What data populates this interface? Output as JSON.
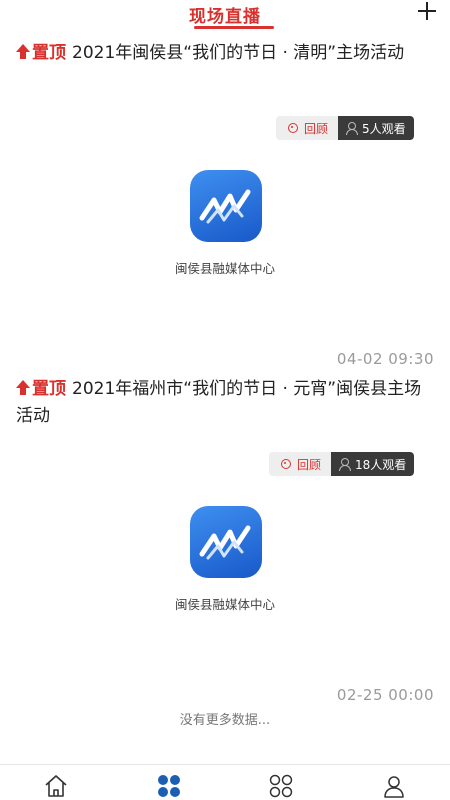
{
  "header": {
    "title": "现场直播"
  },
  "pin_label": "置顶",
  "items": [
    {
      "title": "2021年闽侯县“我们的节日 · 清明”主场活动",
      "replay_label": "回顾",
      "views_label": "5人观看",
      "logo_caption": "闽侯县融媒体中心",
      "time": "04-02 09:30"
    },
    {
      "title": "2021年福州市“我们的节日 · 元宵”闽侯县主场活动",
      "replay_label": "回顾",
      "views_label": "18人观看",
      "logo_caption": "闽侯县融媒体中心",
      "time": "02-25 00:00"
    }
  ],
  "footer_message": "没有更多数据...",
  "tabbar": {
    "tabs": [
      {
        "icon": "home-icon",
        "active": false
      },
      {
        "icon": "grid-dots-icon",
        "active": true
      },
      {
        "icon": "grid-circles-icon",
        "active": false
      },
      {
        "icon": "user-icon",
        "active": false
      }
    ]
  },
  "colors": {
    "accent": "#d9312e",
    "active_tab": "#1a5fb4"
  }
}
